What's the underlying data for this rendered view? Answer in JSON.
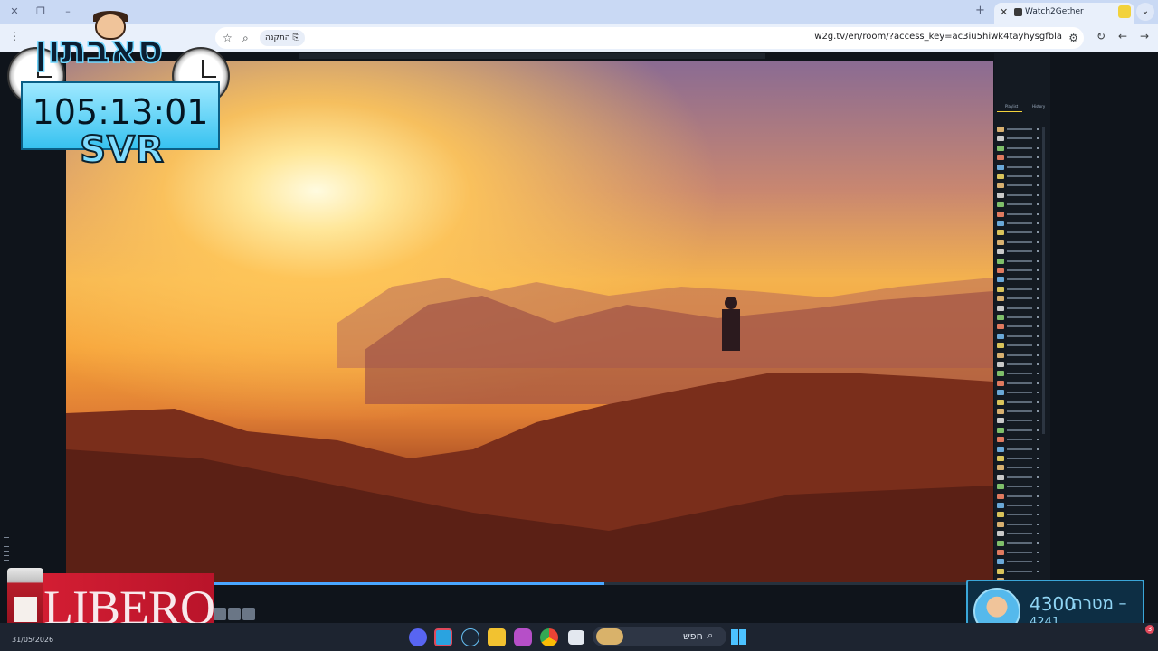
{
  "browser": {
    "tab_title": "Watch2Gether",
    "url": "w2g.tv/en/room/?access_key=ac3iu5hiwk4tayhysgfbla",
    "install_chip": "התקנה"
  },
  "overlay": {
    "brand_text": "סאבתון",
    "timer": "105:13:01",
    "svr": "SVR",
    "sponsor": "LIBERO"
  },
  "goal": {
    "label": "מטרה –",
    "target": "4300",
    "current": "4241"
  },
  "player": {
    "progress_fraction": 0.58
  },
  "playlist": {
    "tab_left": "Playlist",
    "tab_right": "History",
    "item_count": 54
  },
  "taskbar": {
    "search_placeholder": "חפש",
    "date": "31/05/2026",
    "notification_count": "3",
    "apps": [
      "discord-icon",
      "telegram-icon",
      "steam-icon",
      "bee-icon",
      "instagram-icon",
      "chrome-icon",
      "taskview-icon",
      "widgets-icon"
    ]
  },
  "colors": {
    "accent_blue": "#4aa6ff",
    "overlay_cyan": "#37c2f0",
    "sponsor_red": "#c41a2f",
    "panel_bg": "#141a22"
  }
}
